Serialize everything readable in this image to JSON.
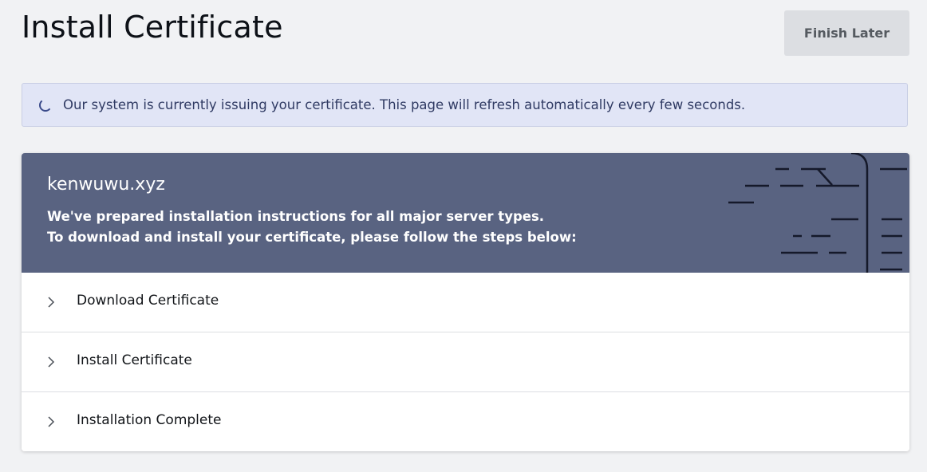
{
  "page": {
    "title": "Install Certificate",
    "finish_later_label": "Finish Later"
  },
  "notice": {
    "icon": "loading-spinner-icon",
    "text": "Our system is currently issuing your certificate. This page will refresh automatically every few seconds."
  },
  "card": {
    "domain": "kenwuwu.xyz",
    "description_line1": "We've prepared installation instructions for all major server types.",
    "description_line2": "To download and install your certificate, please follow the steps below:",
    "steps": [
      {
        "label": "Download Certificate",
        "icon": "chevron-right-icon"
      },
      {
        "label": "Install Certificate",
        "icon": "chevron-right-icon"
      },
      {
        "label": "Installation Complete",
        "icon": "chevron-right-icon"
      }
    ]
  },
  "colors": {
    "background": "#f1f2f4",
    "header_bg": "#596381",
    "notice_bg": "#e1e5f6",
    "notice_text": "#2f3a63",
    "button_bg": "#dcdee2"
  }
}
